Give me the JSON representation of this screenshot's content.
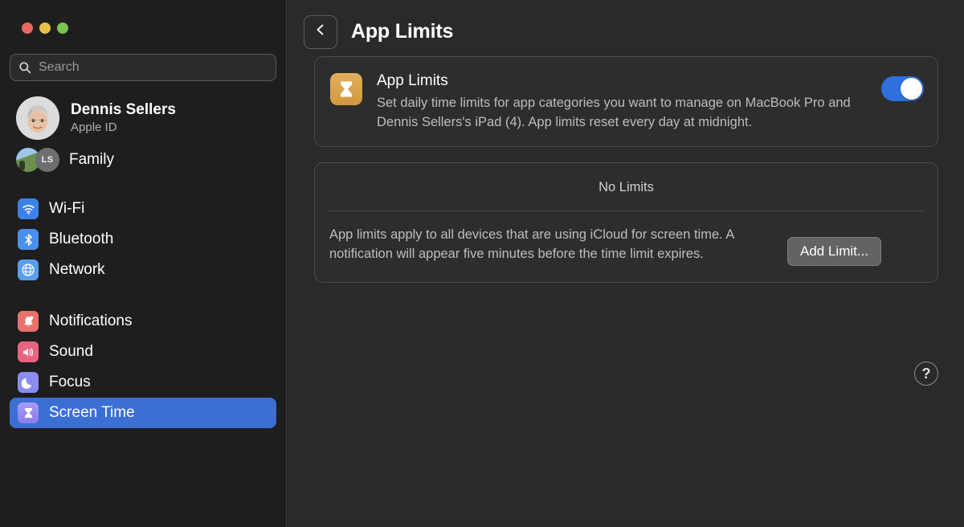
{
  "window": {
    "traffic_lights": [
      {
        "name": "close",
        "color": "#e8685f"
      },
      {
        "name": "minimize",
        "color": "#e5c14c"
      },
      {
        "name": "maximize",
        "color": "#78c551"
      }
    ]
  },
  "sidebar": {
    "search": {
      "placeholder": "Search",
      "value": ""
    },
    "account": {
      "name": "Dennis Sellers",
      "subtitle": "Apple ID"
    },
    "family": {
      "label": "Family",
      "initials": "LS"
    },
    "groups": [
      {
        "items": [
          {
            "label": "Wi-Fi",
            "icon": "wifi-icon",
            "color": "#3b82e8",
            "selected": false
          },
          {
            "label": "Bluetooth",
            "icon": "bluetooth-icon",
            "color": "#4b90ee",
            "selected": false
          },
          {
            "label": "Network",
            "icon": "globe-icon",
            "color": "#5a9ef0",
            "selected": false
          }
        ]
      },
      {
        "items": [
          {
            "label": "Notifications",
            "icon": "bell-icon",
            "color": "#e8716a",
            "selected": false
          },
          {
            "label": "Sound",
            "icon": "speaker-icon",
            "color": "#e8637f",
            "selected": false
          },
          {
            "label": "Focus",
            "icon": "moon-icon",
            "color": "#8b8cf0",
            "selected": false
          },
          {
            "label": "Screen Time",
            "icon": "hourglass-icon",
            "color": "#9a8bf2",
            "selected": true
          }
        ]
      }
    ]
  },
  "main": {
    "back_button": "back-chevron-icon",
    "title": "App Limits",
    "app_limits_card": {
      "icon": "hourglass-icon",
      "icon_color": "#d9a14a",
      "title": "App Limits",
      "description": "Set daily time limits for app categories you want to manage on MacBook Pro and Dennis Sellers's iPad (4). App limits reset every day at midnight.",
      "toggle": {
        "state": "on",
        "color": "#2f6fde"
      }
    },
    "no_limits_card": {
      "header": "No Limits",
      "description": "App limits apply to all devices that are using iCloud for screen time. A notification will appear five minutes before the time limit expires.",
      "add_button": "Add Limit..."
    },
    "help_button": "?"
  }
}
